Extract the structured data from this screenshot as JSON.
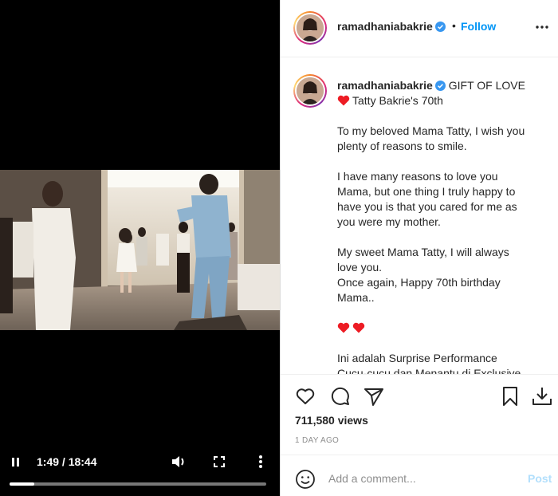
{
  "video": {
    "time_display": "1:49 / 18:44",
    "progress_fraction": 0.097,
    "icons": [
      "pause-icon",
      "volume-icon",
      "fullscreen-icon",
      "more-vertical-icon"
    ]
  },
  "post": {
    "username": "ramadhaniabakrie",
    "verified": true,
    "follow_label": "Follow",
    "separator": "•",
    "caption": {
      "title": "GIFT OF LOVE",
      "subtitle": "Tatty Bakrie's 70th",
      "p1": [
        "To my beloved Mama Tatty, I wish you",
        "plenty of reasons to smile."
      ],
      "p2": [
        "I have many reasons to love you",
        "Mama, but one thing I truly happy to",
        "have you is that you cared for me as",
        "you were my mother."
      ],
      "p3": [
        "My sweet Mama Tatty, I will always",
        "love you.",
        "Once again, Happy 70th birthday",
        "Mama.."
      ],
      "p4": [
        "Ini adalah Surprise Performance",
        "Cucu-cucu dan Menantu di Exclusive"
      ]
    },
    "views": "711,580 views",
    "date": "1 DAY AGO",
    "comment_placeholder": "Add a comment...",
    "post_label": "Post"
  },
  "colors": {
    "follow_blue": "#0095f6",
    "post_disabled": "#b2dffc",
    "heart_red": "#ed1c24",
    "verified_blue": "#3897f0"
  }
}
